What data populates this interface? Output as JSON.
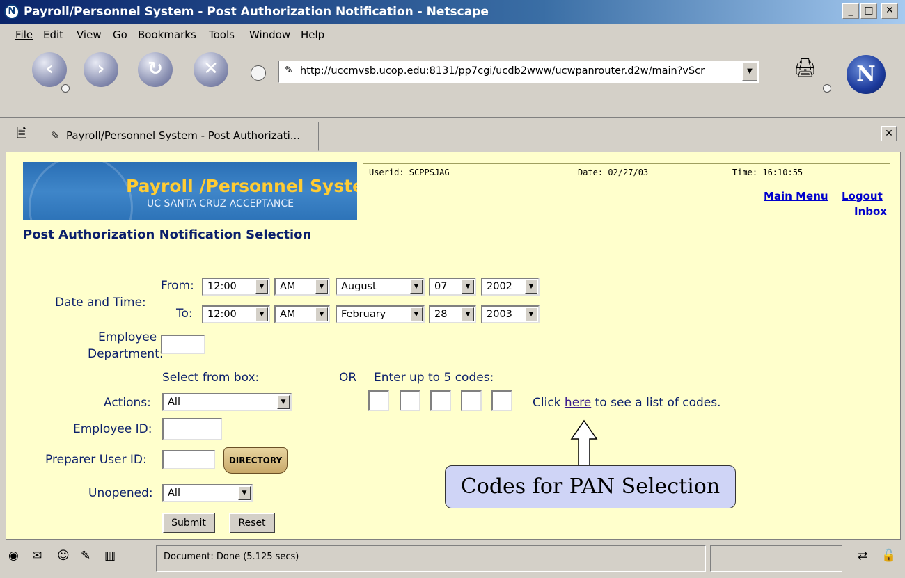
{
  "window": {
    "title": "Payroll/Personnel System - Post Authorization Notification - Netscape",
    "minimize_icon": "minimize-icon",
    "maximize_icon": "maximize-icon",
    "close_icon": "close-icon"
  },
  "menu": [
    "File",
    "Edit",
    "View",
    "Go",
    "Bookmarks",
    "Tools",
    "Window",
    "Help"
  ],
  "nav": {
    "url": "http://uccmvsb.ucop.edu:8131/pp7cgi/ucdb2www/ucwpanrouter.d2w/main?vScr"
  },
  "tab": {
    "label": "Payroll/Personnel System - Post Authorizati..."
  },
  "banner": {
    "title": "Payroll /Personnel System",
    "subtitle": "UC SANTA CRUZ ACCEPTANCE"
  },
  "info": {
    "userid": "Userid: SCPPSJAG",
    "date": "Date: 02/27/03",
    "time": "Time: 16:10:55"
  },
  "links": {
    "main_menu": "Main Menu",
    "logout": "Logout",
    "inbox": "Inbox"
  },
  "page_title": "Post Authorization Notification Selection",
  "form": {
    "date_time_label": "Date and Time:",
    "from_label": "From:",
    "to_label": "To:",
    "from": {
      "time": "12:00",
      "ampm": "AM",
      "month": "August",
      "day": "07",
      "year": "2002"
    },
    "to": {
      "time": "12:00",
      "ampm": "AM",
      "month": "February",
      "day": "28",
      "year": "2003"
    },
    "emp_dept_label_1": "Employee",
    "emp_dept_label_2": "Department:",
    "select_from_box": "Select from box:",
    "or": "OR",
    "enter_codes": "Enter up to 5 codes:",
    "actions_label": "Actions:",
    "actions_value": "All",
    "click_prefix": "Click",
    "click_link": "here",
    "click_suffix": "to see a list of codes.",
    "employee_id_label": "Employee ID:",
    "preparer_label": "Preparer User ID:",
    "directory_label": "DIRECTORY",
    "unopened_label": "Unopened:",
    "unopened_value": "All",
    "submit_label": "Submit",
    "reset_label": "Reset"
  },
  "callout": "Codes for PAN Selection",
  "status": {
    "text": "Document: Done (5.125 secs)"
  },
  "colors": {
    "content_bg": "#ffffcc",
    "label_color": "#0b1f6b",
    "link_color": "#0000cc",
    "callout_bg": "#cfd4f6"
  }
}
